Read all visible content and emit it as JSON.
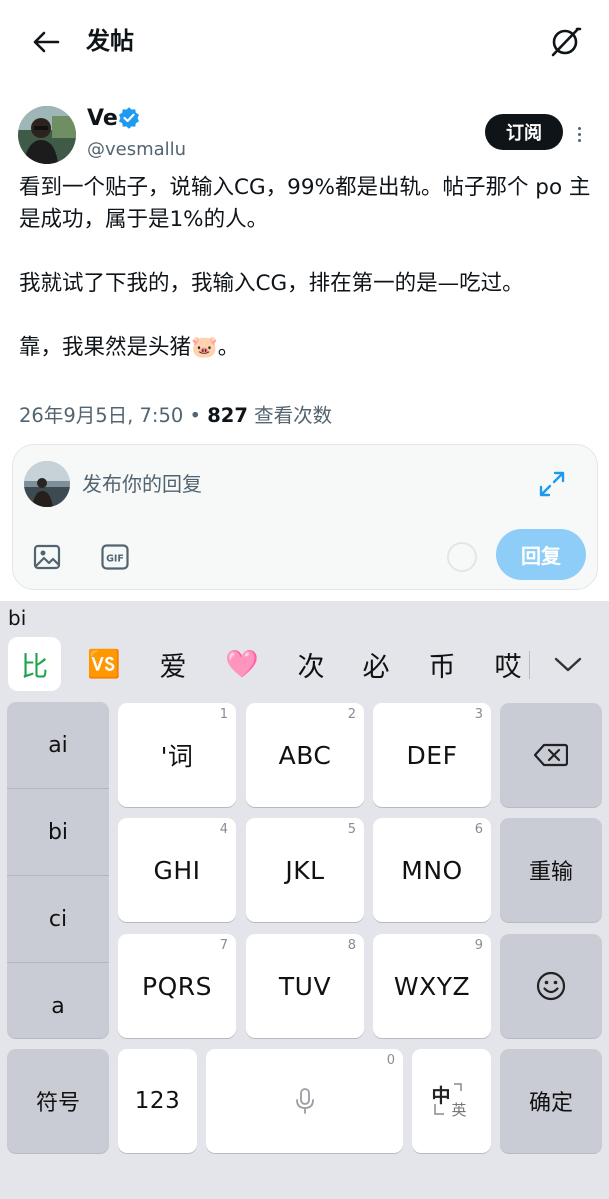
{
  "header": {
    "title": "发帖"
  },
  "post": {
    "author_name": "Ve",
    "handle": "@vesmallu",
    "subscribe_label": "订阅",
    "paragraphs": [
      "看到一个贴子，说输入CG，99%都是出轨。帖子那个 po 主是成功，属于是1%的人。",
      "我就试了下我的，我输入CG，排在第一的是—吃过。",
      "靠，我果然是头猪🐷。"
    ],
    "timestamp": "26年9月5日, 7:50",
    "separator": "•",
    "views_count": "827",
    "views_label": "查看次数"
  },
  "reply": {
    "placeholder": "发布你的回复",
    "button_label": "回复",
    "gif_label": "GIF"
  },
  "keyboard": {
    "pinyin": "bi",
    "candidates": [
      "比",
      "🆚",
      "爱",
      "🩷",
      "次",
      "必",
      "币",
      "哎"
    ],
    "side_options": [
      "ai",
      "bi",
      "ci",
      "a"
    ],
    "keys": [
      {
        "label": "'词",
        "num": "1"
      },
      {
        "label": "ABC",
        "num": "2"
      },
      {
        "label": "DEF",
        "num": "3"
      },
      {
        "label": "GHI",
        "num": "4"
      },
      {
        "label": "JKL",
        "num": "5"
      },
      {
        "label": "MNO",
        "num": "6"
      },
      {
        "label": "PQRS",
        "num": "7"
      },
      {
        "label": "TUV",
        "num": "8"
      },
      {
        "label": "WXYZ",
        "num": "9"
      }
    ],
    "reinput_label": "重输",
    "symbols_label": "符号",
    "numbers_label": "123",
    "space_num": "0",
    "lang_zh": "中",
    "lang_en": "英",
    "confirm_label": "确定"
  },
  "colors": {
    "accent_blue": "#1d9bf0",
    "reply_button_disabled": "#8ecdf7",
    "candidate_selected": "#1fa34a"
  }
}
